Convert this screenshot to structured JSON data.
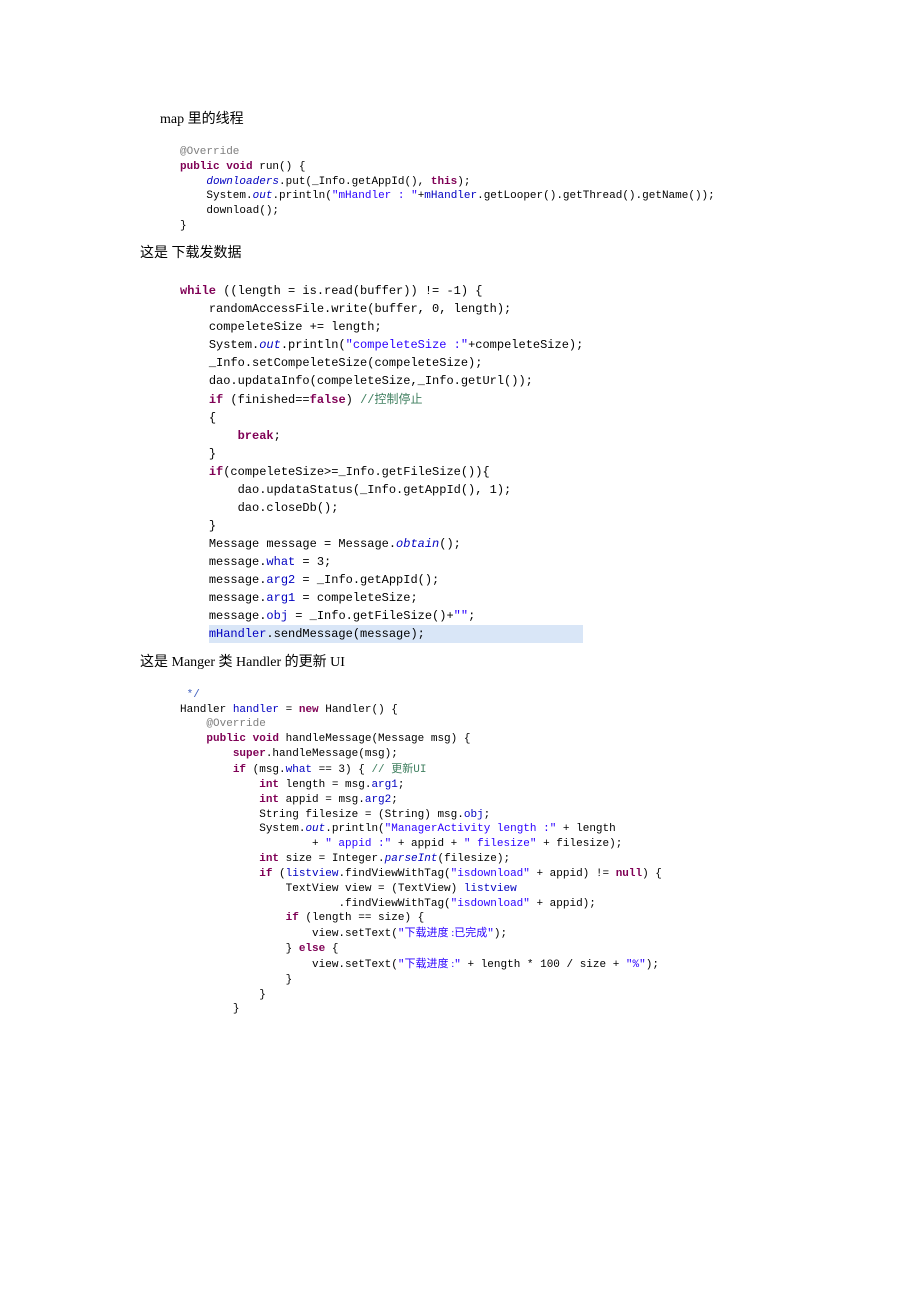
{
  "headings": {
    "h1": "map 里的线程",
    "h2": "这是 下载发数据",
    "h3": "这是 Manger 类  Handler 的更新 UI"
  },
  "code1": {
    "l1a": "@Override",
    "l2a": "public",
    "l2b": " ",
    "l2c": "void",
    "l2d": " run() {",
    "l3a": "downloaders",
    "l3b": ".put(_Info.getAppId(), ",
    "l3c": "this",
    "l3d": ");",
    "l4a": "System.",
    "l4b": "out",
    "l4c": ".println(",
    "l4d": "\"mHandler : \"",
    "l4e": "+",
    "l4f": "mHandler",
    "l4g": ".getLooper().getThread().getName());",
    "l5": "download();",
    "l6": "}"
  },
  "code2": {
    "l1a": "while",
    "l1b": " ((length = is.read(buffer)) != -1) {",
    "l2": "randomAccessFile.write(buffer, 0, length);",
    "l3": "compeleteSize += length;",
    "l4a": "System.",
    "l4b": "out",
    "l4c": ".println(",
    "l4d": "\"compeleteSize :\"",
    "l4e": "+compeleteSize);",
    "l5": "_Info.setCompeleteSize(compeleteSize);",
    "l6": "dao.updataInfo(compeleteSize,_Info.getUrl());",
    "l7a": "if",
    "l7b": " (finished==",
    "l7c": "false",
    "l7d": ") ",
    "l7e": "//",
    "l7f": "控制停止",
    "l8": "{",
    "l9a": "break",
    "l9b": ";",
    "l10": "}",
    "l11a": "if",
    "l11b": "(compeleteSize>=_Info.getFileSize()){",
    "l12": "dao.updataStatus(_Info.getAppId(), 1);",
    "l13": "dao.closeDb();",
    "l14": "}",
    "l15a": "Message message = Message.",
    "l15b": "obtain",
    "l15c": "();",
    "l16a": "message.",
    "l16b": "what",
    "l16c": " = 3;",
    "l17a": "message.",
    "l17b": "arg2",
    "l17c": " = _Info.getAppId();",
    "l18a": "message.",
    "l18b": "arg1",
    "l18c": " = compeleteSize;",
    "l19a": "message.",
    "l19b": "obj",
    "l19c": " = _Info.getFileSize()+",
    "l19d": "\"\"",
    "l19e": ";",
    "l20a": "mHandler",
    "l20b": ".sendMessage(message);"
  },
  "code3": {
    "l0": " */",
    "l1a": "Handler ",
    "l1b": "handler",
    "l1c": " = ",
    "l1d": "new",
    "l1e": " Handler() {",
    "l2": "@Override",
    "l3a": "public",
    "l3b": " ",
    "l3c": "void",
    "l3d": " handleMessage(Message msg) {",
    "l4a": "super",
    "l4b": ".handleMessage(msg);",
    "l5a": "if",
    "l5b": " (msg.",
    "l5c": "what",
    "l5d": " == 3) { ",
    "l5e": "// ",
    "l5f": "更新",
    "l5g": "UI",
    "l6a": "int",
    "l6b": " length = msg.",
    "l6c": "arg1",
    "l6d": ";",
    "l7a": "int",
    "l7b": " appid = msg.",
    "l7c": "arg2",
    "l7d": ";",
    "l8a": "String filesize = (String) msg.",
    "l8b": "obj",
    "l8c": ";",
    "l9a": "System.",
    "l9b": "out",
    "l9c": ".println(",
    "l9d": "\"ManagerActivity length :\"",
    "l9e": " + length",
    "l10a": "+ ",
    "l10b": "\" appid :\"",
    "l10c": " + appid + ",
    "l10d": "\" filesize\"",
    "l10e": " + filesize);",
    "l11a": "int",
    "l11b": " size = Integer.",
    "l11c": "parseInt",
    "l11d": "(filesize);",
    "l12a": "if",
    "l12b": " (",
    "l12c": "listview",
    "l12d": ".findViewWithTag(",
    "l12e": "\"isdownload\"",
    "l12f": " + appid) != ",
    "l12g": "null",
    "l12h": ") {",
    "l13a": "TextView view = (TextView) ",
    "l13b": "listview",
    "l14a": ".findViewWithTag(",
    "l14b": "\"isdownload\"",
    "l14c": " + appid);",
    "l15a": "if",
    "l15b": " (length == size) {",
    "l16a": "view.setText(",
    "l16b": "\"",
    "l16c": "下载进度 :已完成",
    "l16d": "\"",
    "l16e": ");",
    "l17a": "} ",
    "l17b": "else",
    "l17c": " {",
    "l18a": "view.setText(",
    "l18b": "\"",
    "l18c": "下载进度 :",
    "l18d": "\"",
    "l18e": " + length * 100 / size + ",
    "l18f": "\"%\"",
    "l18g": ");",
    "l19": "}",
    "l20": "}",
    "l21": "}"
  }
}
